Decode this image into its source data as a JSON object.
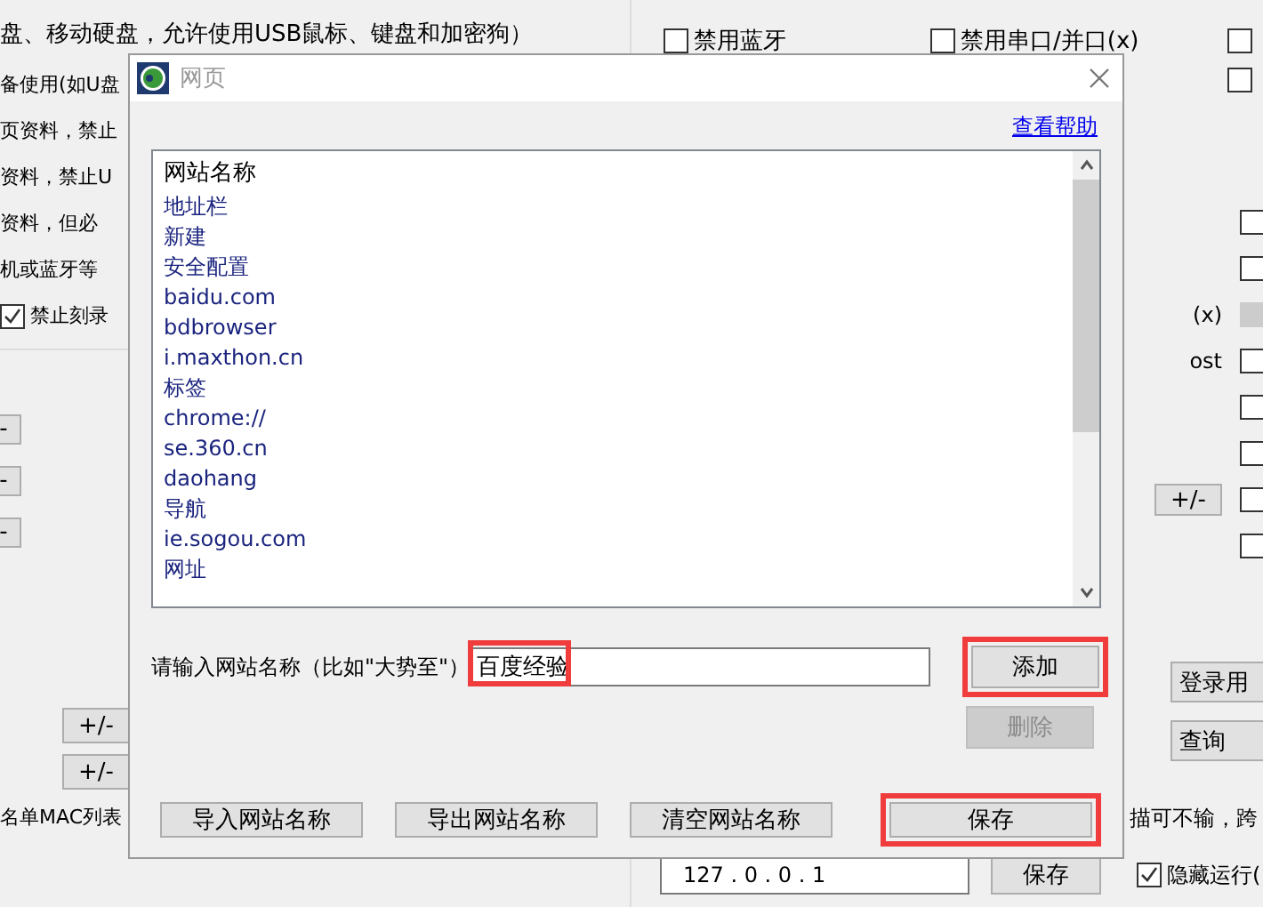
{
  "background": {
    "top_line": "盘、移动硬盘，允许使用USB鼠标、键盘和加密狗）",
    "left_lines": [
      "备使用(如U盘",
      "页资料，禁止",
      "资料，禁止U",
      "资料，但必",
      "机或蓝牙等"
    ],
    "burn_checkbox": {
      "label": "禁止刻录",
      "checked": true
    },
    "minus_buttons": [
      "-",
      "-",
      "-"
    ],
    "plus_minus_buttons": [
      "+/-",
      "+/-"
    ],
    "mac_label": "名单MAC列表",
    "top_checkboxes": [
      {
        "label": "禁用蓝牙",
        "checked": false
      },
      {
        "label": "禁用串口/并口(x)",
        "checked": false
      },
      {
        "checked": false
      }
    ],
    "second_row_checkbox": {
      "checked": false
    },
    "strip_rows": [
      {
        "checked": false,
        "disabled": false
      },
      {
        "checked": false,
        "disabled": false
      },
      {
        "text": "(x)",
        "checked": false,
        "disabled": true
      },
      {
        "text": "ost",
        "checked": false,
        "disabled": false
      },
      {
        "checked": false,
        "disabled": false
      },
      {
        "checked": false,
        "disabled": false
      },
      {
        "button": "+/-",
        "checked": false,
        "disabled": false
      },
      {
        "checked": false,
        "disabled": false
      }
    ],
    "strip_buttons": [
      "登录用",
      "查询"
    ],
    "strip_text": "描可不输，跨",
    "ip_field": "127 . 0 . 0 . 1",
    "save_button": "保存",
    "hide_checkbox": {
      "label": "隐藏运行(",
      "checked": true
    }
  },
  "dialog": {
    "title": "网页",
    "help_link": "查看帮助",
    "list_header": "网站名称",
    "list_items": [
      "地址栏",
      "新建",
      "安全配置",
      "baidu.com",
      "bdbrowser",
      "i.maxthon.cn",
      "标签",
      "chrome://",
      "se.360.cn",
      "daohang",
      "导航",
      "ie.sogou.com",
      "网址"
    ],
    "input_label": "请输入网站名称（比如\"大势至\"）",
    "input_value": "百度经验",
    "side_buttons": [
      {
        "label": "添加",
        "disabled": false,
        "highlighted": true
      },
      {
        "label": "删除",
        "disabled": true,
        "highlighted": false
      }
    ],
    "bottom_buttons": [
      {
        "label": "导入网站名称",
        "highlighted": false
      },
      {
        "label": "导出网站名称",
        "highlighted": false
      },
      {
        "label": "清空网站名称",
        "highlighted": false
      }
    ],
    "save_button": {
      "label": "保存",
      "highlighted": true
    }
  }
}
